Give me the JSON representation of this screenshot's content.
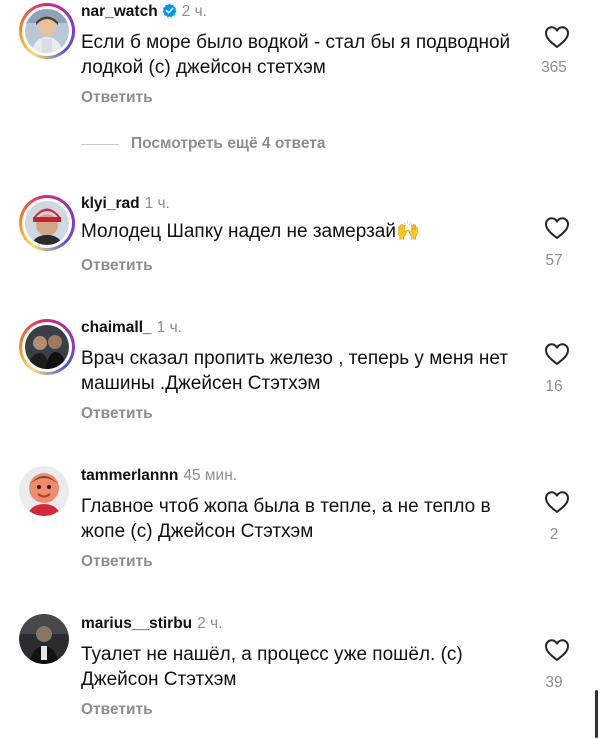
{
  "colors": {
    "text": "#111111",
    "muted": "#8e8e8e",
    "verified": "#0095f6",
    "ring": [
      "#feda75",
      "#fa7e1e",
      "#d62976",
      "#962fbf",
      "#4f5bd5"
    ]
  },
  "comments": [
    {
      "username": "nar_watch",
      "verified": true,
      "time": "2 ч.",
      "text": "Если б море было водкой - стал бы я подводной лодкой (с) джейсон стетхэм",
      "reply_label": "Ответить",
      "likes": "365",
      "icon": "heart-icon"
    },
    {
      "username": "klyi_rad",
      "verified": false,
      "time": "1 ч.",
      "text": "Молодец Шапку надел не замерзай🙌",
      "reply_label": "Ответить",
      "likes": "57",
      "icon": "heart-icon"
    },
    {
      "username": "chaimall_",
      "verified": false,
      "time": "1 ч.",
      "text": "Врач сказал пропить железо , теперь у меня нет машины .Джейсен Стэтхэм",
      "reply_label": "Ответить",
      "likes": "16",
      "icon": "heart-icon"
    },
    {
      "username": "tammerlannn",
      "verified": false,
      "time": "45 мин.",
      "text": "Главное чтоб жопа была в тепле, а не тепло в жопе (с) Джейсон Стэтхэм",
      "reply_label": "Ответить",
      "likes": "2",
      "icon": "heart-icon"
    },
    {
      "username": "marius__stirbu",
      "verified": false,
      "time": "2 ч.",
      "text": "Туалет не нашёл, а процесс уже пошёл. (с) Джейсон Стэтхэм",
      "reply_label": "Ответить",
      "likes": "39",
      "icon": "heart-icon"
    }
  ],
  "more_replies": "Посмотреть ещё 4 ответа"
}
